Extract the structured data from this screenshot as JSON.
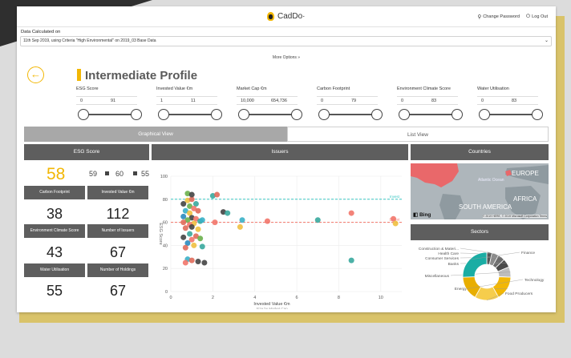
{
  "header": {
    "brand": "CadDo·",
    "change_password": "Change Password",
    "log_out": "Log Out"
  },
  "data_calculated": {
    "label": "Data Calculated on",
    "value": "11th Sep 2019, using Criteria \"High Environmental\" on 2019_03 Base Data"
  },
  "more_options": "More Options »",
  "page_title": "Intermediate Profile",
  "filters": [
    {
      "label": "ESG Score",
      "min": "0",
      "max": "91"
    },
    {
      "label": "Invested Value €m",
      "min": "1",
      "max": "11"
    },
    {
      "label": "Market Cap €m",
      "min": "10,000",
      "max": "654,736"
    },
    {
      "label": "Carbon Footprint",
      "min": "0",
      "max": "79"
    },
    {
      "label": "Environment Climate Score",
      "min": "0",
      "max": "83"
    },
    {
      "label": "Water Utilisation",
      "min": "0",
      "max": "83"
    }
  ],
  "tabs": {
    "graphical": "Graphical View",
    "list": "List View"
  },
  "panels": {
    "esg": "ESG Score",
    "issuers": "Issuers",
    "countries": "Countries",
    "sectors": "Sectors"
  },
  "esg": {
    "main": "58",
    "left": "59",
    "middle": "60",
    "right": "55"
  },
  "metrics": [
    {
      "label": "Carbon Footprint",
      "value": "38"
    },
    {
      "label": "Invested Value €m",
      "value": "112"
    },
    {
      "label": "Environment Climate Score",
      "value": "43"
    },
    {
      "label": "Number of Issuers",
      "value": "67"
    },
    {
      "label": "Water Utilisation",
      "value": "55"
    },
    {
      "label": "Number of Holdings",
      "value": "67"
    }
  ],
  "chart_data": {
    "type": "scatter",
    "xlabel": "Invested Value €m",
    "sublabel": "Size by Market Cap",
    "ylabel": "ESG Score",
    "xlim": [
      0,
      11
    ],
    "ylim": [
      0,
      100
    ],
    "xticks": [
      "0",
      "2",
      "4",
      "6",
      "8",
      "10"
    ],
    "yticks": [
      "0",
      "20",
      "40",
      "60",
      "80",
      "100"
    ],
    "reference_lines": [
      {
        "name": "Invest",
        "y": 80,
        "color": "#39c6c2"
      },
      {
        "name": "Divest",
        "y": 60,
        "color": "#f2756a"
      }
    ],
    "points": [
      [
        0.8,
        79,
        "#f0c040"
      ],
      [
        1.0,
        80,
        "#e06a5a"
      ],
      [
        1.2,
        76,
        "#38a89d"
      ],
      [
        0.6,
        76,
        "#444"
      ],
      [
        0.9,
        74,
        "#6ab04c"
      ],
      [
        1.1,
        72,
        "#f2756a"
      ],
      [
        0.7,
        70,
        "#38b0c8"
      ],
      [
        1.3,
        70,
        "#e06a5a"
      ],
      [
        0.9,
        68,
        "#f0c040"
      ],
      [
        0.6,
        65,
        "#2a8bbf"
      ],
      [
        1.0,
        64,
        "#444"
      ],
      [
        1.2,
        63,
        "#f2756a"
      ],
      [
        0.8,
        62,
        "#6ab04c"
      ],
      [
        1.4,
        61,
        "#38a89d"
      ],
      [
        0.6,
        60,
        "#e06a5a"
      ],
      [
        1.1,
        59,
        "#f0c040"
      ],
      [
        0.9,
        58,
        "#f2756a"
      ],
      [
        1.5,
        62,
        "#38b0c8"
      ],
      [
        1.0,
        56,
        "#444"
      ],
      [
        0.7,
        55,
        "#e06a5a"
      ],
      [
        1.3,
        54,
        "#f0c040"
      ],
      [
        0.9,
        50,
        "#38a89d"
      ],
      [
        1.2,
        48,
        "#e06a5a"
      ],
      [
        0.6,
        47,
        "#444"
      ],
      [
        1.0,
        45,
        "#f2756a"
      ],
      [
        1.4,
        46,
        "#6ab04c"
      ],
      [
        0.8,
        42,
        "#2a8bbf"
      ],
      [
        1.1,
        40,
        "#f0c040"
      ],
      [
        0.7,
        38,
        "#e06a5a"
      ],
      [
        1.5,
        39,
        "#38a89d"
      ],
      [
        0.8,
        28,
        "#38b0c8"
      ],
      [
        1.0,
        27,
        "#e06a5a"
      ],
      [
        1.3,
        26,
        "#444"
      ],
      [
        0.7,
        25,
        "#f2756a"
      ],
      [
        1.6,
        25,
        "#444"
      ],
      [
        0.8,
        85,
        "#6ab04c"
      ],
      [
        1.0,
        84,
        "#444"
      ],
      [
        2.0,
        83,
        "#38a89d"
      ],
      [
        2.2,
        84,
        "#e06a5a"
      ],
      [
        2.5,
        69,
        "#444"
      ],
      [
        2.7,
        68,
        "#38a89d"
      ],
      [
        2.1,
        60,
        "#f2756a"
      ],
      [
        3.4,
        62,
        "#38b0c8"
      ],
      [
        3.3,
        56,
        "#f0c040"
      ],
      [
        4.6,
        61,
        "#f2756a"
      ],
      [
        7.0,
        62,
        "#38a89d"
      ],
      [
        8.6,
        68,
        "#f2756a"
      ],
      [
        10.6,
        63,
        "#f2756a"
      ],
      [
        10.7,
        59,
        "#f0c040"
      ],
      [
        8.6,
        27,
        "#38a89d"
      ]
    ]
  },
  "map": {
    "labels": [
      "EUROPE",
      "Atlantic Ocean",
      "SOUTH AMERICA",
      "AFRICA"
    ],
    "provider": "Bing",
    "attribution": "© 2019 HERE, © 2019 Microsoft Corporation Terms"
  },
  "sectors_data": {
    "type": "pie",
    "labels": [
      "Construction & Materi...",
      "Health Care",
      "Consumer Services",
      "Banks",
      "Miscellaneous",
      "Energy",
      "Food Producers",
      "Technology",
      "Finance"
    ],
    "values": [
      3,
      4,
      4,
      5,
      6,
      14,
      14,
      14,
      22
    ],
    "colors": [
      "#555555",
      "#8a8a8a",
      "#6d6d6d",
      "#4a4a4a",
      "#bdbdbd",
      "#f2b705",
      "#f2b705",
      "#f2b705",
      "#1aada4"
    ]
  }
}
